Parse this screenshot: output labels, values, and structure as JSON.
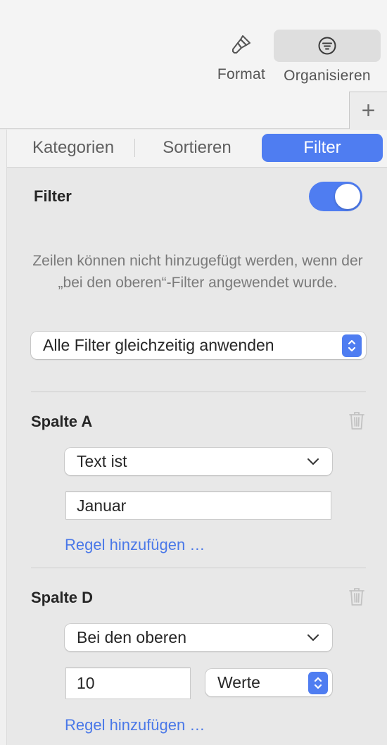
{
  "toolbar": {
    "format_label": "Format",
    "organise_label": "Organisieren",
    "add_label": "+"
  },
  "tabs": {
    "categories": "Kategorien",
    "sort": "Sortieren",
    "filter": "Filter",
    "active": "Filter"
  },
  "filter_panel": {
    "title": "Filter",
    "enabled": true,
    "info_text": "Zeilen können nicht hinzugefügt werden, wenn der „bei den oberen“-Filter angewendet wurde.",
    "mode_select": "Alle Filter gleichzeitig anwenden"
  },
  "rules": [
    {
      "column": "Spalte A",
      "condition": "Text ist",
      "value": "Januar",
      "add_rule": "Regel hinzufügen …"
    },
    {
      "column": "Spalte D",
      "condition": "Bei den oberen",
      "value": "10",
      "unit": "Werte",
      "add_rule": "Regel hinzufügen …"
    }
  ],
  "colors": {
    "accent": "#4f7df1",
    "link": "#4a78e8"
  },
  "icons": {
    "format": "paintbrush-icon",
    "organise": "filter-lines-icon",
    "delete": "trash-icon",
    "dropdown": "chevron-down-icon",
    "stepper": "up-down-stepper-icon"
  }
}
